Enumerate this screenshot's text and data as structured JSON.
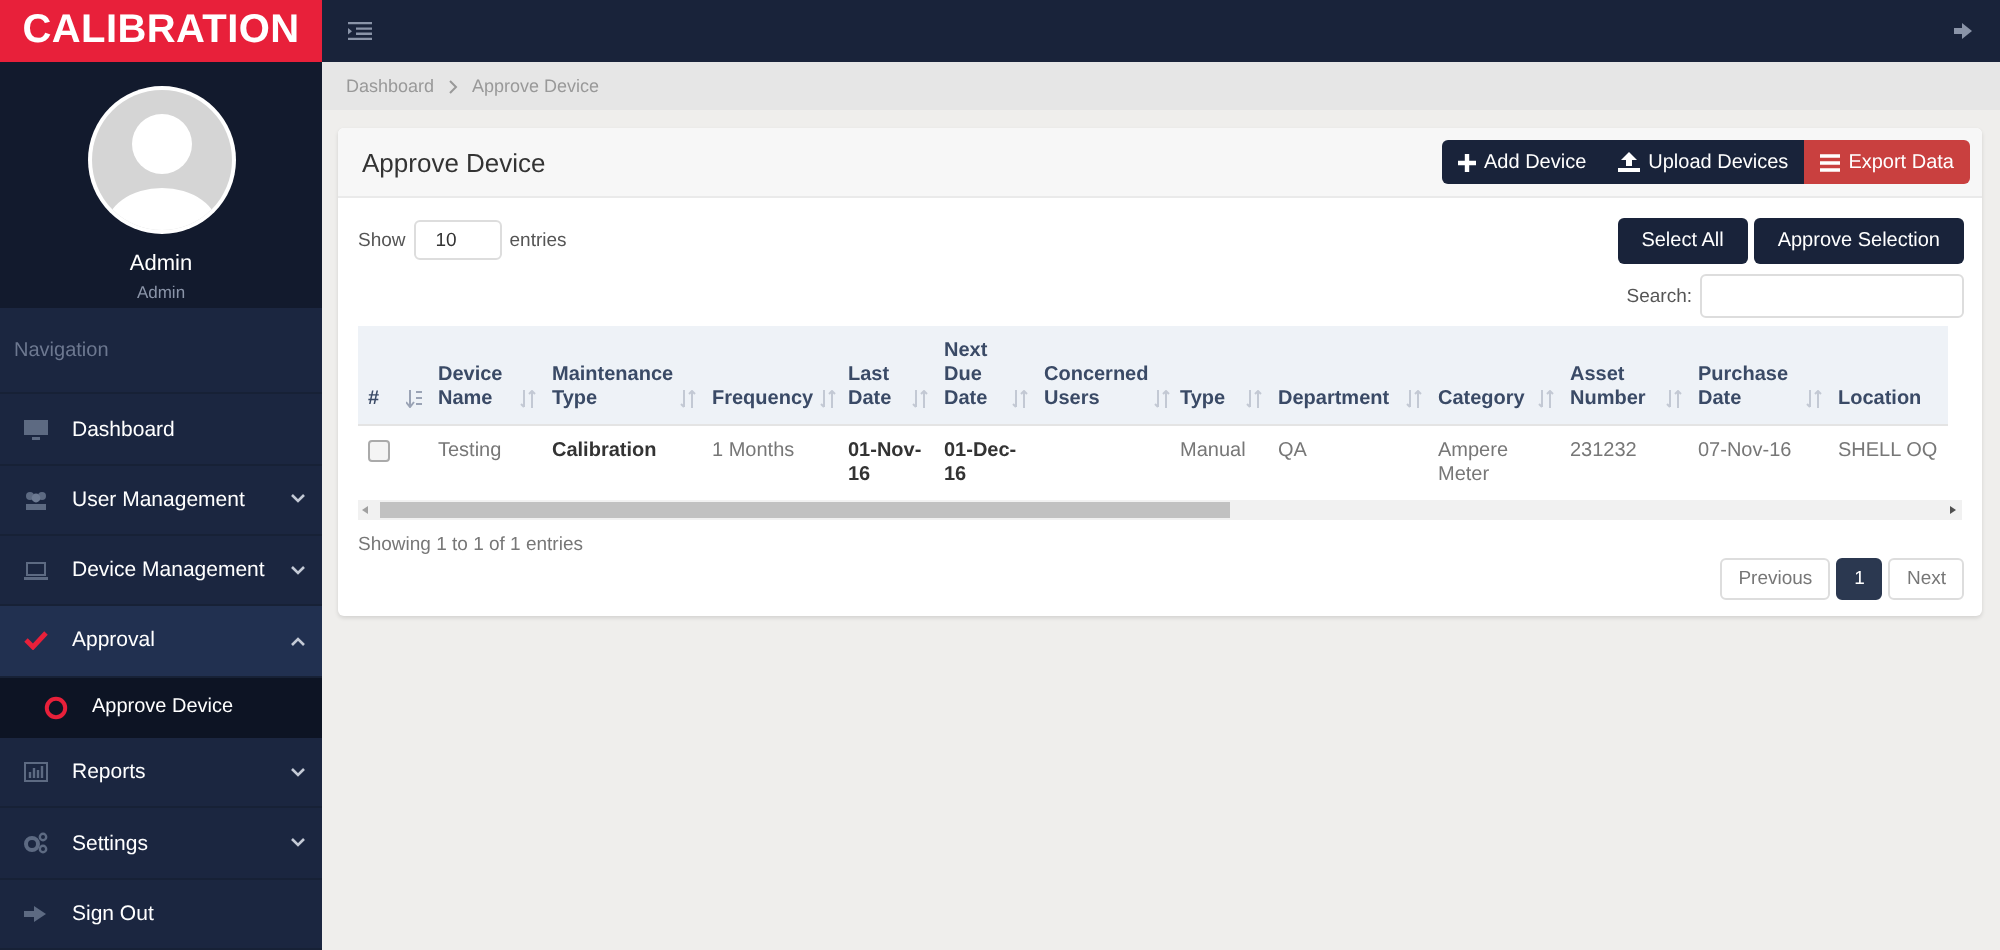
{
  "brand": "CALIBRATION",
  "profile": {
    "name": "Admin",
    "role": "Admin"
  },
  "nav_heading": "Navigation",
  "sidebar": {
    "items": [
      {
        "label": "Dashboard",
        "kind": "link",
        "selected": false
      },
      {
        "label": "User Management",
        "kind": "menu",
        "expanded": false,
        "selected": false
      },
      {
        "label": "Device Management",
        "kind": "menu",
        "expanded": false,
        "selected": false
      },
      {
        "label": "Approval",
        "kind": "menu",
        "expanded": true,
        "selected": true,
        "children": [
          {
            "label": "Approve Device",
            "selected": true
          }
        ]
      },
      {
        "label": "Reports",
        "kind": "menu",
        "expanded": false,
        "selected": false
      },
      {
        "label": "Settings",
        "kind": "menu",
        "expanded": false,
        "selected": false
      },
      {
        "label": "Sign Out",
        "kind": "link",
        "selected": false
      }
    ]
  },
  "breadcrumb": [
    "Dashboard",
    "Approve Device"
  ],
  "card": {
    "title": "Approve Device",
    "actions": [
      {
        "label": "Add Device",
        "kind": "add"
      },
      {
        "label": "Upload Devices",
        "kind": "upload"
      },
      {
        "label": "Export Data",
        "kind": "export"
      }
    ],
    "show": {
      "before": "Show",
      "value": "10",
      "after": "entries"
    },
    "buttons": [
      "Select All",
      "Approve Selection"
    ],
    "search_label": "Search:",
    "table": {
      "columns": [
        {
          "label": "#",
          "sorted": true
        },
        {
          "label": "Device Name",
          "sorted": false
        },
        {
          "label": "Maintenance Type",
          "sorted": false
        },
        {
          "label": "Frequency",
          "sorted": false
        },
        {
          "label": "Last Date",
          "sorted": false
        },
        {
          "label": "Next Due Date",
          "sorted": false
        },
        {
          "label": "Concerned Users",
          "sorted": false
        },
        {
          "label": "Type",
          "sorted": false
        },
        {
          "label": "Department",
          "sorted": false
        },
        {
          "label": "Category",
          "sorted": false
        },
        {
          "label": "Asset Number",
          "sorted": false
        },
        {
          "label": "Purchase Date",
          "sorted": false
        },
        {
          "label": "Location"
        }
      ],
      "rows": [
        {
          "selected": false,
          "cells": [
            "",
            "Testing",
            "Calibration",
            "1 Months",
            "01-Nov-16",
            "01-Dec-16",
            "",
            "Manual",
            "QA",
            "Ampere Meter",
            "231232",
            "07-Nov-16",
            "SHELL OQ"
          ]
        }
      ]
    },
    "info": "Showing 1 to 1 of 1 entries",
    "pagination": [
      {
        "label": "Previous",
        "selected": false
      },
      {
        "label": "1",
        "selected": true
      },
      {
        "label": "Next",
        "selected": false
      }
    ]
  }
}
